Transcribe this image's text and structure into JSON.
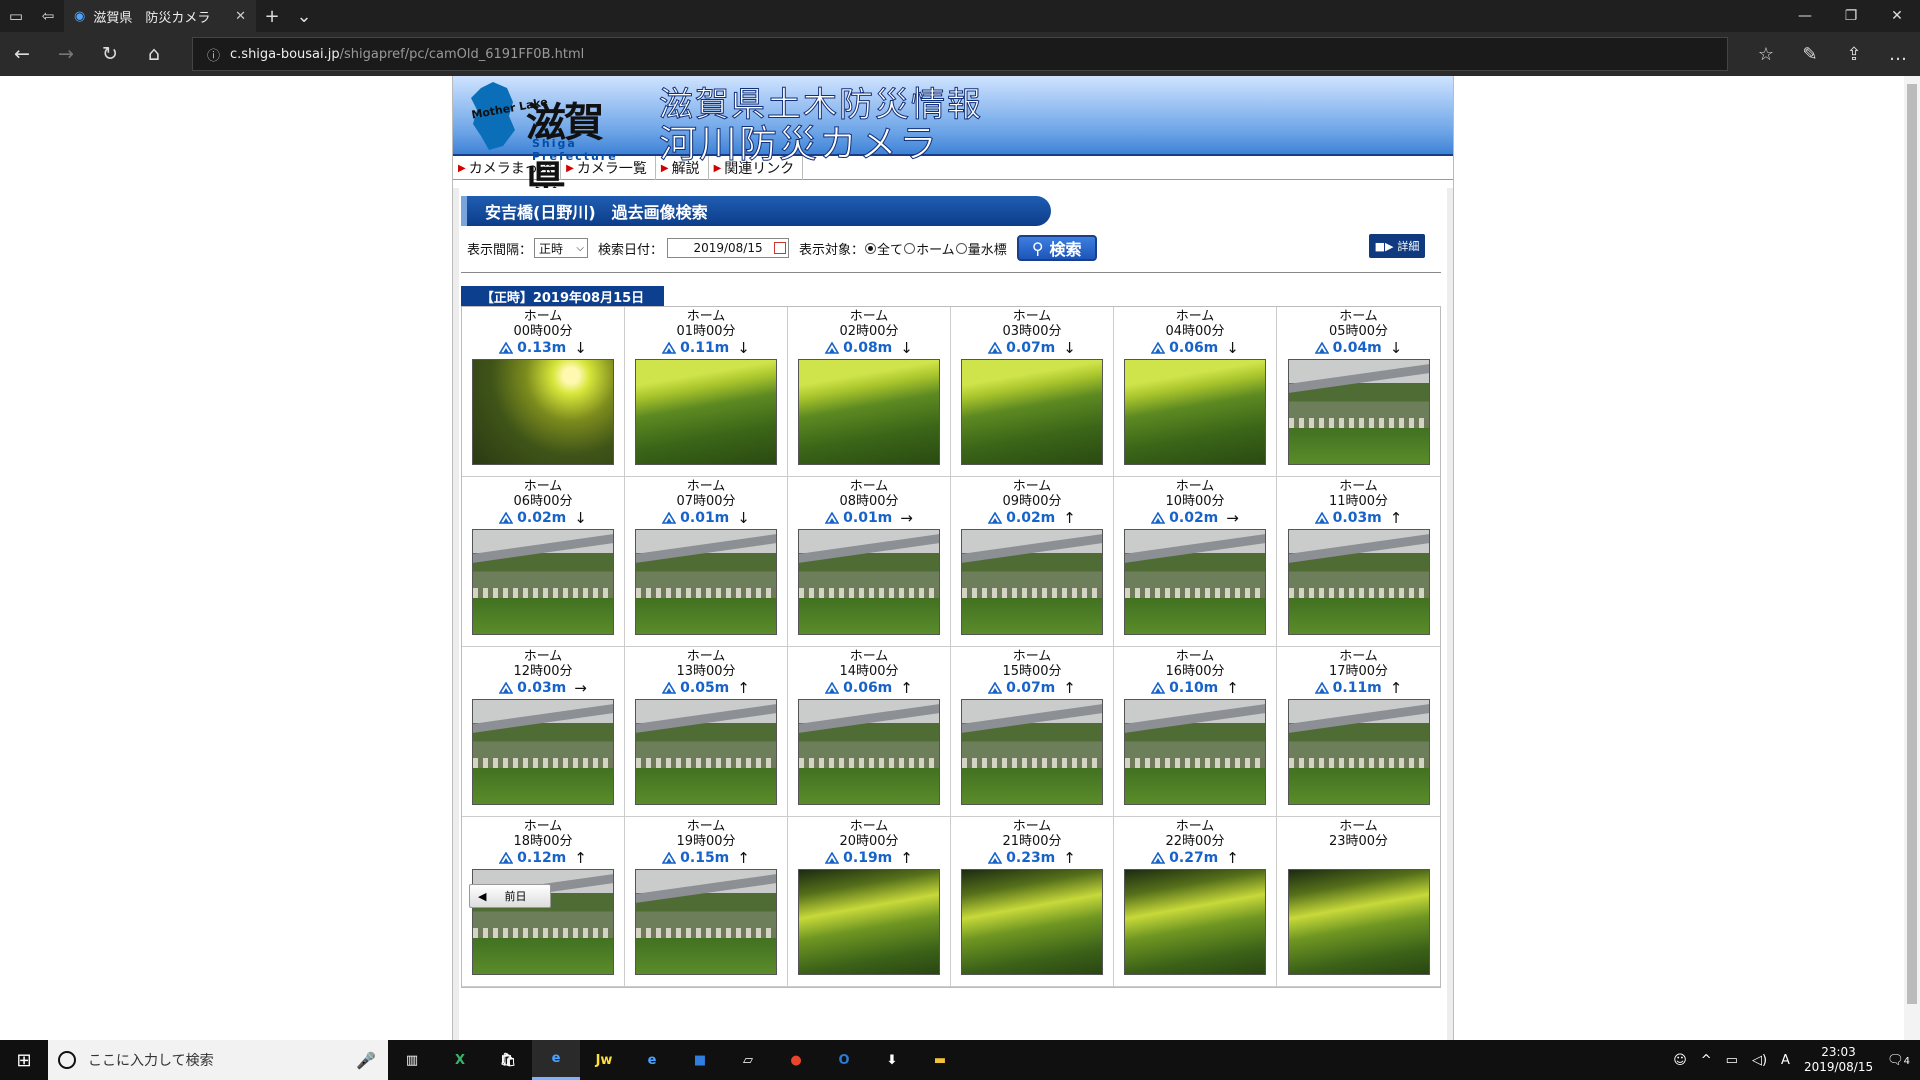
{
  "browser": {
    "tab_title": "滋賀県　防災カメラ",
    "url_host": "c.shiga-bousai.jp",
    "url_path": "/shigapref/pc/camOld_6191FF0B.html"
  },
  "header": {
    "logo_name": "滋賀県",
    "logo_sub": "Shiga Prefecture",
    "logo_ml": "Mother Lake",
    "title_line1": "滋賀県土木防災情報",
    "title_line2": "河川防災カメラ"
  },
  "menu": [
    {
      "label": "カメラまっぷ"
    },
    {
      "label": "カメラ一覧"
    },
    {
      "label": "解説"
    },
    {
      "label": "関連リンク"
    }
  ],
  "section_title": "安吉橋(日野川)　過去画像検索",
  "filter": {
    "interval_label": "表示間隔：",
    "interval_value": "正時",
    "date_label": "検索日付：",
    "date_value": "2019/08/15",
    "target_label": "表示対象：",
    "opt_all": "全て",
    "opt_home": "ホーム",
    "opt_gauge": "量水標",
    "search_label": "検索",
    "detail_label": "詳細"
  },
  "date_head": "【正時】2019年08月15日",
  "cells": [
    {
      "cam": "ホーム",
      "time": "00時00分",
      "level": "0.13m",
      "arrow": "↓",
      "img": "glare"
    },
    {
      "cam": "ホーム",
      "time": "01時00分",
      "level": "0.11m",
      "arrow": "↓",
      "img": "sun"
    },
    {
      "cam": "ホーム",
      "time": "02時00分",
      "level": "0.08m",
      "arrow": "↓",
      "img": "sun"
    },
    {
      "cam": "ホーム",
      "time": "03時00分",
      "level": "0.07m",
      "arrow": "↓",
      "img": "sun"
    },
    {
      "cam": "ホーム",
      "time": "04時00分",
      "level": "0.06m",
      "arrow": "↓",
      "img": "sun"
    },
    {
      "cam": "ホーム",
      "time": "05時00分",
      "level": "0.04m",
      "arrow": "↓",
      "img": "day"
    },
    {
      "cam": "ホーム",
      "time": "06時00分",
      "level": "0.02m",
      "arrow": "↓",
      "img": "day"
    },
    {
      "cam": "ホーム",
      "time": "07時00分",
      "level": "0.01m",
      "arrow": "↓",
      "img": "day"
    },
    {
      "cam": "ホーム",
      "time": "08時00分",
      "level": "0.01m",
      "arrow": "→",
      "img": "day"
    },
    {
      "cam": "ホーム",
      "time": "09時00分",
      "level": "0.02m",
      "arrow": "↑",
      "img": "day"
    },
    {
      "cam": "ホーム",
      "time": "10時00分",
      "level": "0.02m",
      "arrow": "→",
      "img": "day"
    },
    {
      "cam": "ホーム",
      "time": "11時00分",
      "level": "0.03m",
      "arrow": "↑",
      "img": "day"
    },
    {
      "cam": "ホーム",
      "time": "12時00分",
      "level": "0.03m",
      "arrow": "→",
      "img": "day"
    },
    {
      "cam": "ホーム",
      "time": "13時00分",
      "level": "0.05m",
      "arrow": "↑",
      "img": "day"
    },
    {
      "cam": "ホーム",
      "time": "14時00分",
      "level": "0.06m",
      "arrow": "↑",
      "img": "day"
    },
    {
      "cam": "ホーム",
      "time": "15時00分",
      "level": "0.07m",
      "arrow": "↑",
      "img": "day"
    },
    {
      "cam": "ホーム",
      "time": "16時00分",
      "level": "0.10m",
      "arrow": "↑",
      "img": "day"
    },
    {
      "cam": "ホーム",
      "time": "17時00分",
      "level": "0.11m",
      "arrow": "↑",
      "img": "day"
    },
    {
      "cam": "ホーム",
      "time": "18時00分",
      "level": "0.12m",
      "arrow": "↑",
      "img": "day"
    },
    {
      "cam": "ホーム",
      "time": "19時00分",
      "level": "0.15m",
      "arrow": "↑",
      "img": "day"
    },
    {
      "cam": "ホーム",
      "time": "20時00分",
      "level": "0.19m",
      "arrow": "↑",
      "img": "dusk"
    },
    {
      "cam": "ホーム",
      "time": "21時00分",
      "level": "0.23m",
      "arrow": "↑",
      "img": "dusk"
    },
    {
      "cam": "ホーム",
      "time": "22時00分",
      "level": "0.27m",
      "arrow": "↑",
      "img": "dusk"
    },
    {
      "cam": "ホーム",
      "time": "23時00分",
      "level": "",
      "arrow": "",
      "img": "dusk"
    }
  ],
  "prev_day_label": "前日",
  "taskbar": {
    "search_placeholder": "ここに入力して検索",
    "clock_time": "23:03",
    "clock_date": "2019/08/15",
    "notify_count": "4",
    "ime_label": "A"
  }
}
